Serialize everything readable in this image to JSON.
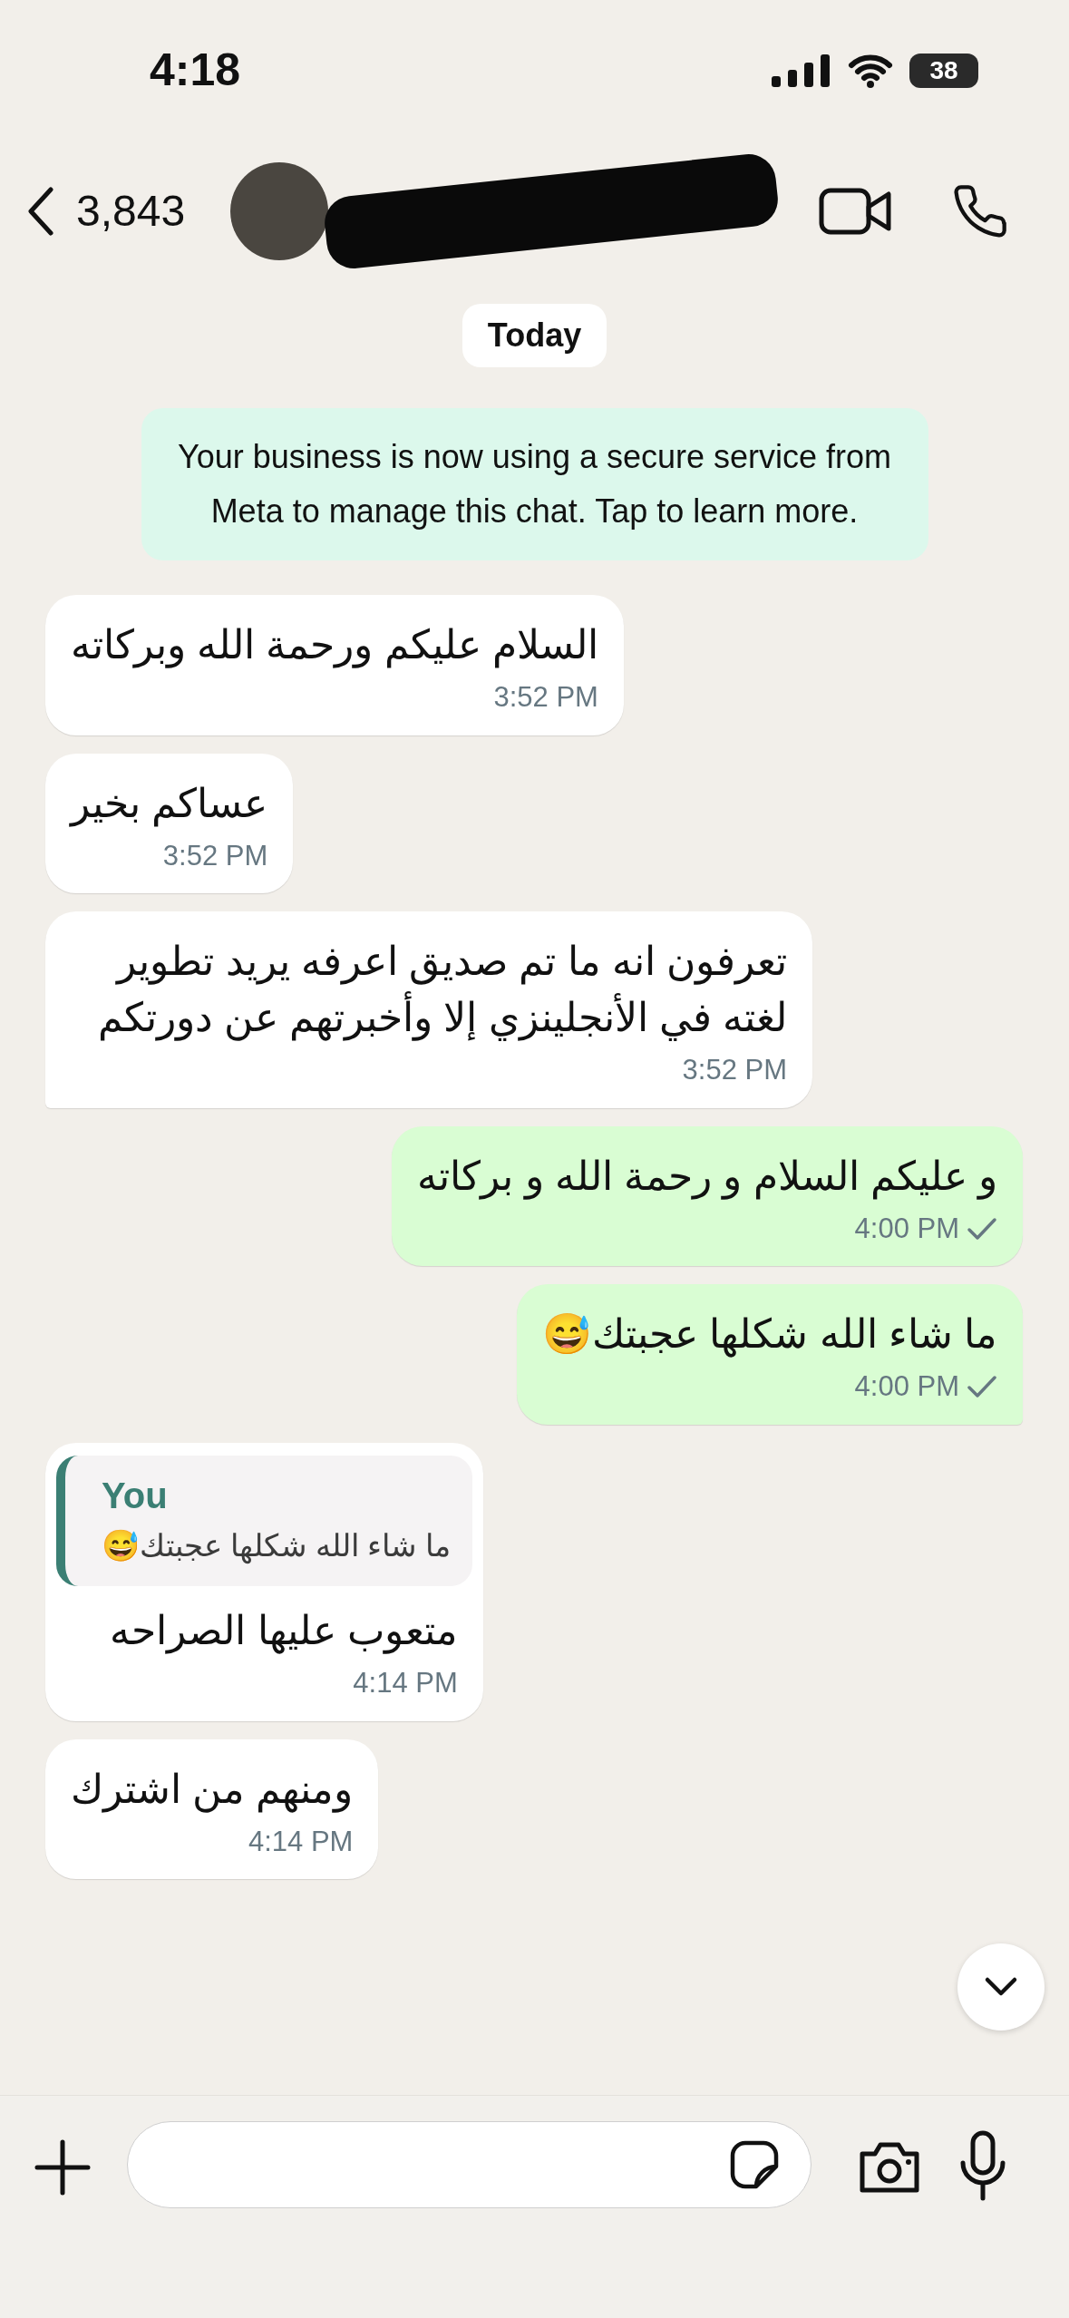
{
  "status_bar": {
    "time": "4:18",
    "battery": "38"
  },
  "header": {
    "back_count": "3,843",
    "name_redacted": true
  },
  "date_pill": "Today",
  "system_notice": "Your business is now using a secure service from Meta to manage this chat. Tap to learn more.",
  "messages": [
    {
      "kind": "incoming",
      "text": "السلام عليكم ورحمة الله وبركاته",
      "time": "3:52 PM",
      "tail": false
    },
    {
      "kind": "incoming",
      "text": "عساكم بخير",
      "time": "3:52 PM",
      "tail": false
    },
    {
      "kind": "incoming",
      "text": "تعرفون انه ما تم صديق اعرفه يريد تطوير لغته في الأنجلينزي إلا وأخبرتهم عن دورتكم",
      "time": "3:52 PM",
      "tail": true
    },
    {
      "kind": "outgoing",
      "text": "و عليكم السلام و رحمة الله و بركاته",
      "time": "4:00 PM",
      "read": false,
      "tail": false
    },
    {
      "kind": "outgoing",
      "text": "ما شاء الله شكلها عجبتك😅",
      "time": "4:00 PM",
      "read": false,
      "tail": true
    },
    {
      "kind": "incoming",
      "reply_to": {
        "author": "You",
        "text": "ما شاء الله شكلها عجبتك😅"
      },
      "text": "متعوب عليها الصراحه",
      "time": "4:14 PM",
      "tail": false
    },
    {
      "kind": "incoming",
      "text": "ومنهم من اشترك",
      "time": "4:14 PM",
      "tail": false
    }
  ]
}
